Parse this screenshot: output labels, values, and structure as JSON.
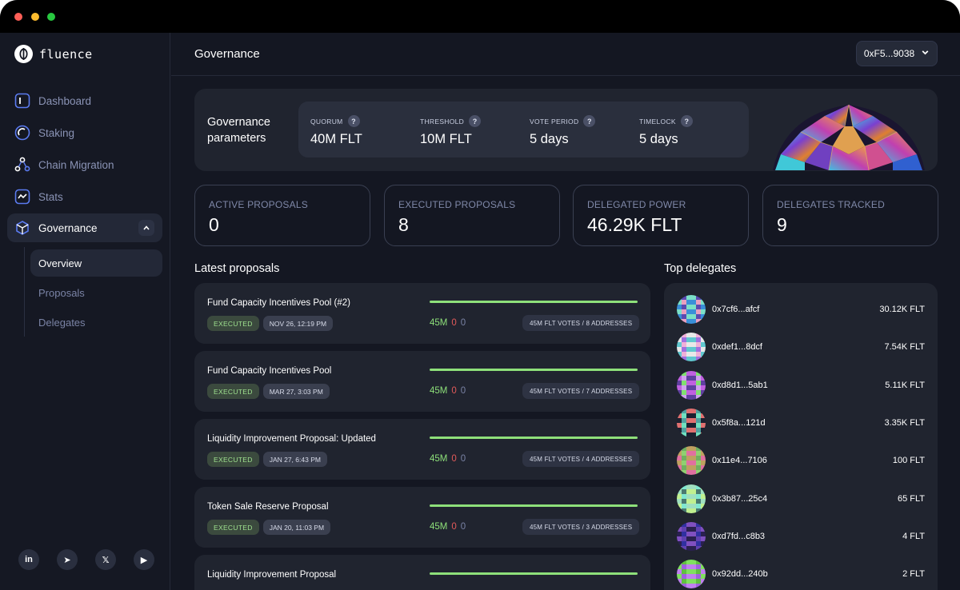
{
  "brand": {
    "name": "fluence"
  },
  "sidebar": {
    "items": [
      {
        "label": "Dashboard",
        "icon": "dashboard-icon"
      },
      {
        "label": "Staking",
        "icon": "staking-icon"
      },
      {
        "label": "Chain Migration",
        "icon": "chain-migration-icon"
      },
      {
        "label": "Stats",
        "icon": "stats-icon"
      },
      {
        "label": "Governance",
        "icon": "governance-icon",
        "active": true
      }
    ],
    "subitems": [
      {
        "label": "Overview",
        "active": true
      },
      {
        "label": "Proposals"
      },
      {
        "label": "Delegates"
      }
    ],
    "socials": [
      "in",
      "➤",
      "𝕏",
      "▶"
    ]
  },
  "header": {
    "title": "Governance",
    "wallet": "0xF5...9038"
  },
  "params": {
    "title": "Governance parameters",
    "items": [
      {
        "label": "QUORUM",
        "value": "40M FLT"
      },
      {
        "label": "THRESHOLD",
        "value": "10M FLT"
      },
      {
        "label": "VOTE PERIOD",
        "value": "5 days"
      },
      {
        "label": "TIMELOCK",
        "value": "5 days"
      }
    ],
    "help_glyph": "?"
  },
  "stats": [
    {
      "label": "ACTIVE PROPOSALS",
      "value": "0"
    },
    {
      "label": "EXECUTED PROPOSALS",
      "value": "8"
    },
    {
      "label": "DELEGATED POWER",
      "value": "46.29K FLT"
    },
    {
      "label": "DELEGATES TRACKED",
      "value": "9"
    }
  ],
  "proposals": {
    "title": "Latest proposals",
    "items": [
      {
        "title": "Fund Capacity Incentives Pool (#2)",
        "status": "EXECUTED",
        "date": "NOV 26, 12:19 PM",
        "for": "45M",
        "against": "0",
        "abstain": "0",
        "summary": "45M FLT VOTES / 8 ADDRESSES"
      },
      {
        "title": "Fund Capacity Incentives Pool",
        "status": "EXECUTED",
        "date": "MAR 27, 3:03 PM",
        "for": "45M",
        "against": "0",
        "abstain": "0",
        "summary": "45M FLT VOTES / 7 ADDRESSES"
      },
      {
        "title": "Liquidity Improvement Proposal: Updated",
        "status": "EXECUTED",
        "date": "JAN 27, 6:43 PM",
        "for": "45M",
        "against": "0",
        "abstain": "0",
        "summary": "45M FLT VOTES / 4 ADDRESSES"
      },
      {
        "title": "Token Sale Reserve Proposal",
        "status": "EXECUTED",
        "date": "JAN 20, 11:03 PM",
        "for": "45M",
        "against": "0",
        "abstain": "0",
        "summary": "45M FLT VOTES / 3 ADDRESSES"
      },
      {
        "title": "Liquidity Improvement Proposal",
        "status": "",
        "date": "",
        "for": "",
        "against": "",
        "abstain": "",
        "summary": ""
      }
    ]
  },
  "delegates": {
    "title": "Top delegates",
    "items": [
      {
        "address": "0x7cf6...afcf",
        "amount": "30.12K FLT",
        "colors": [
          "#3a8fd8",
          "#e8a0c0",
          "#7be0c8",
          "#5a4ab0"
        ]
      },
      {
        "address": "0xdef1...8dcf",
        "amount": "7.54K FLT",
        "colors": [
          "#f0b0d8",
          "#60c8d0",
          "#a070e0",
          "#e8e8e8"
        ]
      },
      {
        "address": "0xd8d1...5ab1",
        "amount": "5.11K FLT",
        "colors": [
          "#c060e0",
          "#80e070",
          "#6040a0",
          "#d0a0f0"
        ]
      },
      {
        "address": "0x5f8a...121d",
        "amount": "3.35K FLT",
        "colors": [
          "#70e0c0",
          "#e07070",
          "#50a0a0",
          "#1c2030"
        ]
      },
      {
        "address": "0x11e4...7106",
        "amount": "100 FLT",
        "colors": [
          "#e070a0",
          "#90d070",
          "#c0a060",
          "#70b060"
        ]
      },
      {
        "address": "0x3b87...25c4",
        "amount": "65 FLT",
        "colors": [
          "#80e8d0",
          "#c0f090",
          "#4a7a70",
          "#a0e0c0"
        ]
      },
      {
        "address": "0xd7fd...c8b3",
        "amount": "4 FLT",
        "colors": [
          "#8050c0",
          "#3030a0",
          "#2a2050",
          "#6040b0"
        ]
      },
      {
        "address": "0x92dd...240b",
        "amount": "2 FLT",
        "colors": [
          "#a060e0",
          "#80e060",
          "#60c040",
          "#c080f0"
        ]
      }
    ]
  }
}
